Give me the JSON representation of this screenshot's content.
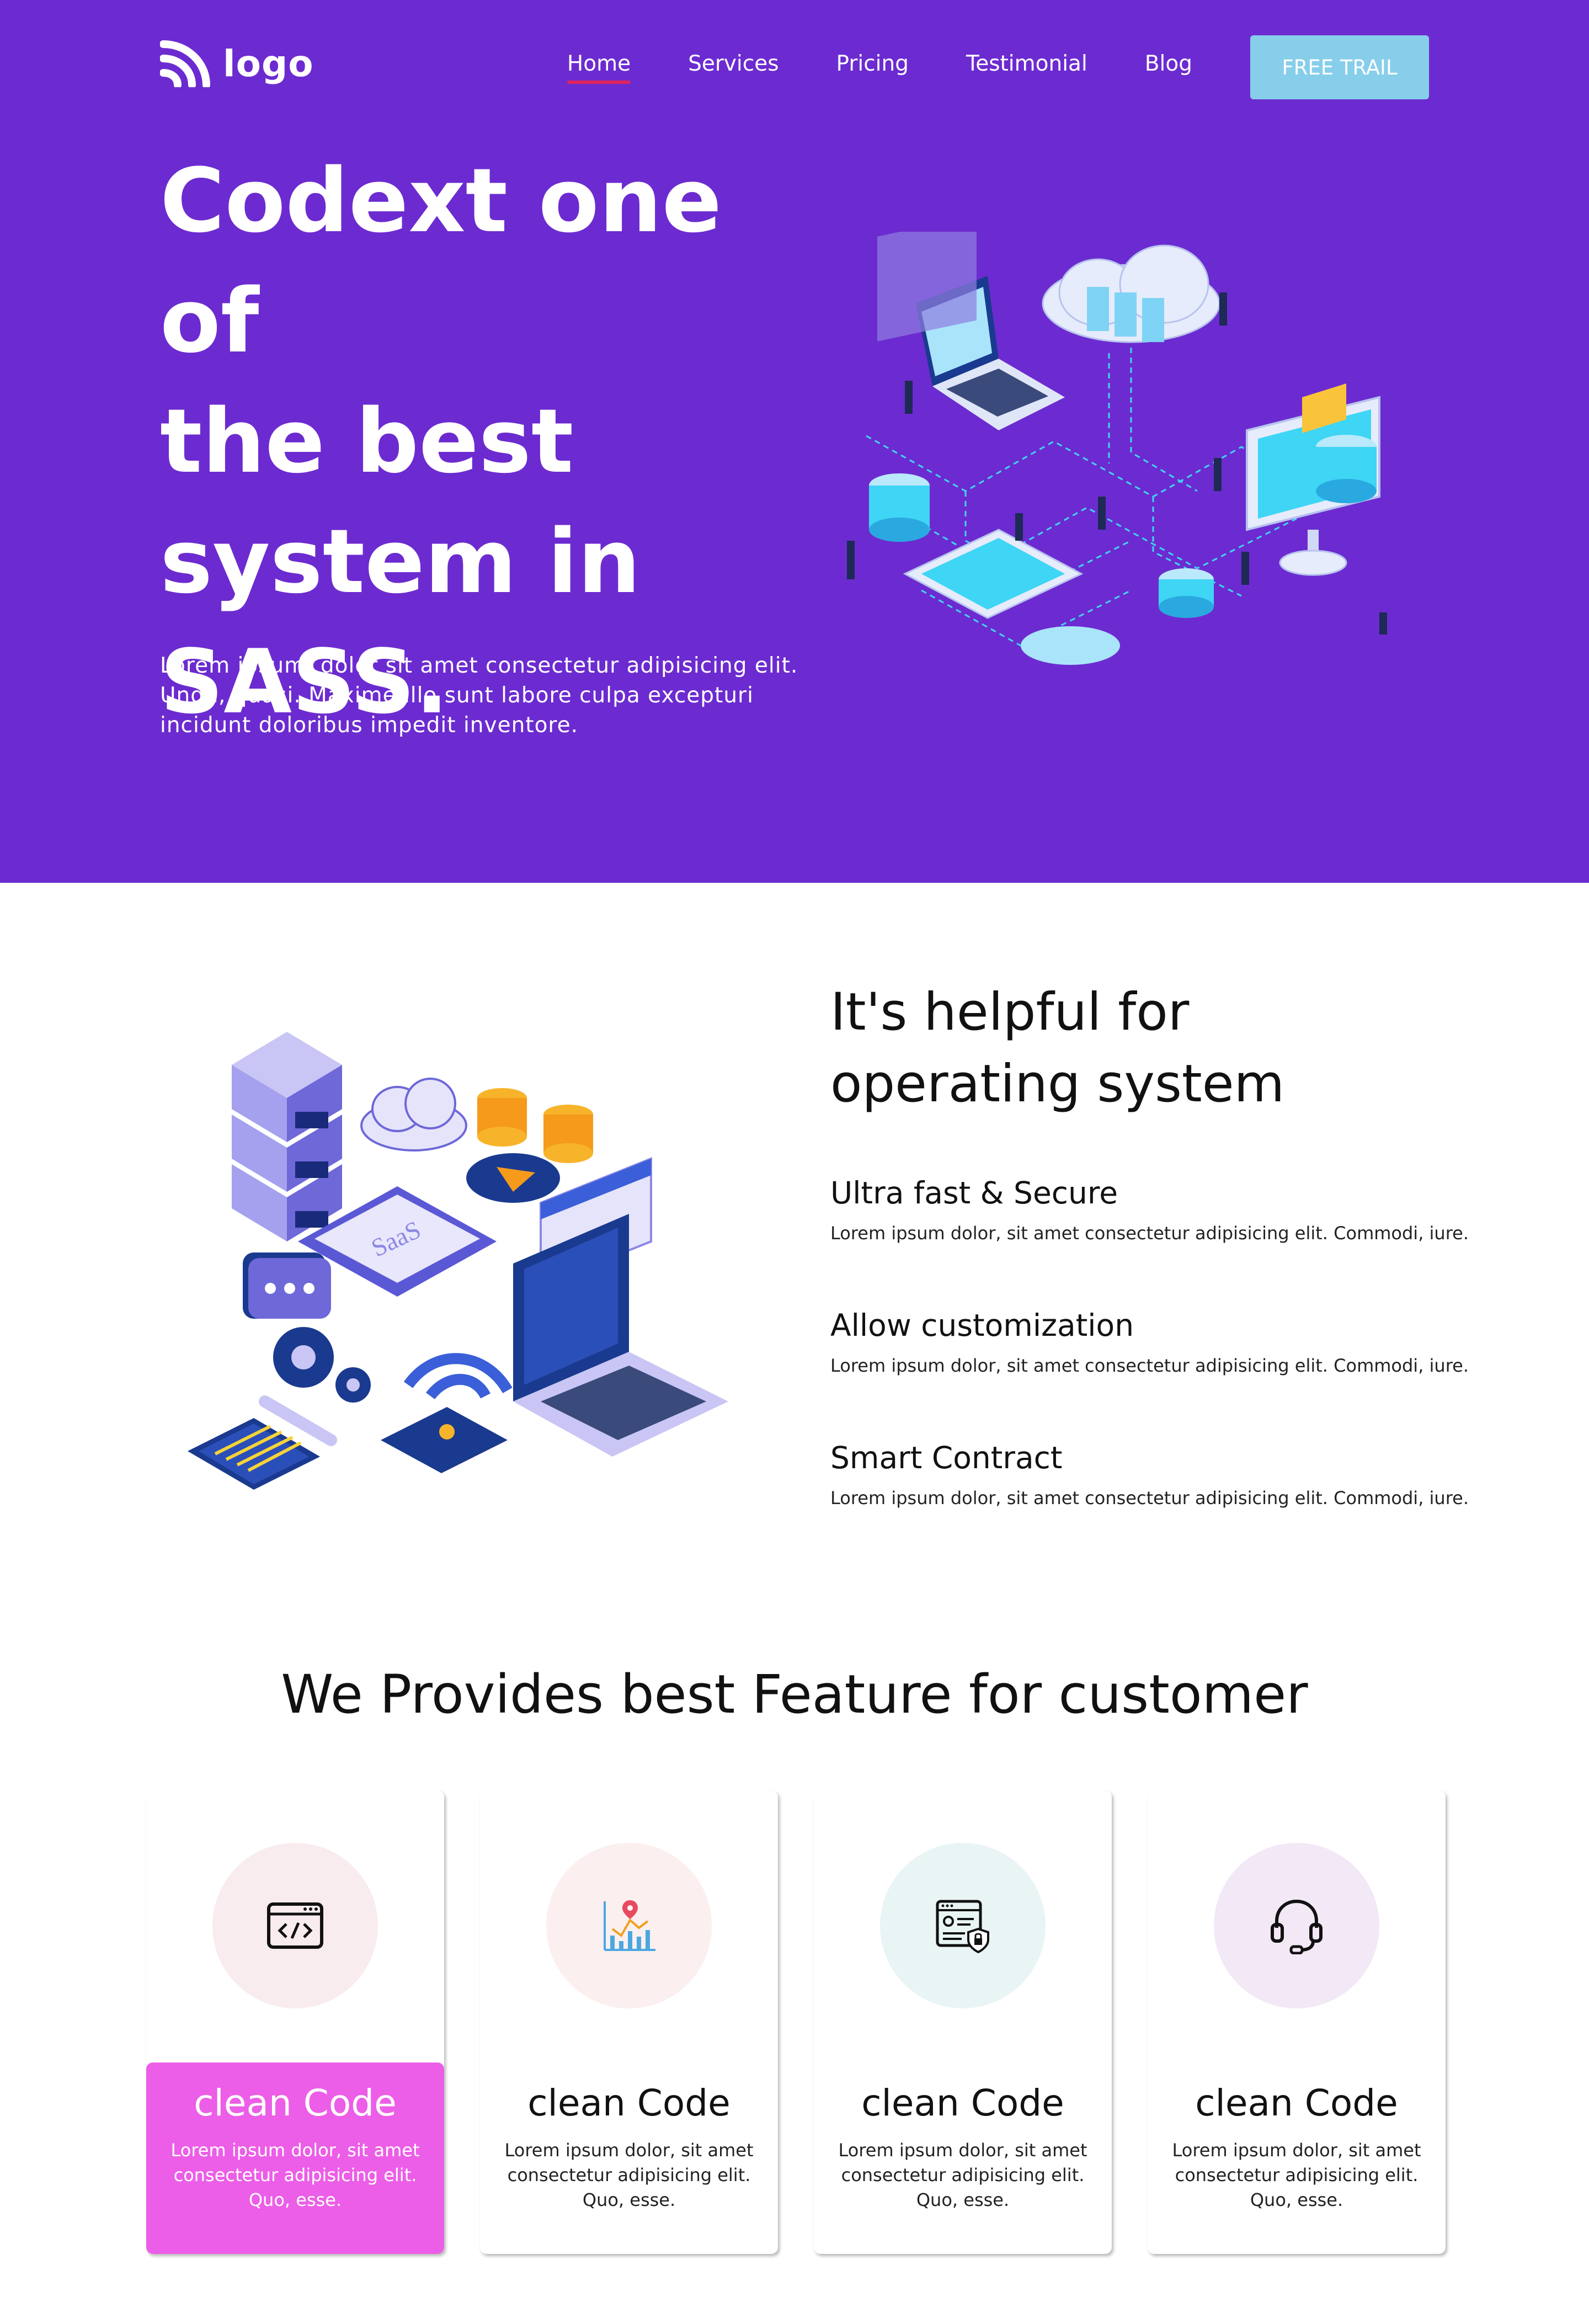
{
  "nav": {
    "logo_text": "logo",
    "items": [
      {
        "label": "Home",
        "active": true
      },
      {
        "label": "Services"
      },
      {
        "label": "Pricing"
      },
      {
        "label": "Testimonial"
      },
      {
        "label": "Blog"
      }
    ],
    "cta_label": "FREE TRAIL"
  },
  "hero": {
    "title_lines": [
      "Codext one of",
      "the best",
      "system in",
      "SASS."
    ],
    "description": "Lorem ipsum, dolor sit amet consectetur adipisicing elit. Unde, quasi. Maxime illo sunt labore culpa excepturi incidunt doloribus impedit inventore."
  },
  "helpful": {
    "title_lines": [
      "It's helpful for",
      "operating system"
    ],
    "illustration_badge": "SaaS",
    "features": [
      {
        "title": "Ultra fast & Secure",
        "text": "Lorem ipsum dolor, sit amet consectetur adipisicing elit. Commodi, iure."
      },
      {
        "title": "Allow customization",
        "text": "Lorem ipsum dolor, sit amet consectetur adipisicing elit. Commodi, iure."
      },
      {
        "title": "Smart Contract",
        "text": "Lorem ipsum dolor, sit amet consectetur adipisicing elit. Commodi, iure."
      }
    ]
  },
  "features_section": {
    "title": "We Provides best Feature for customer",
    "cards": [
      {
        "icon": "code-window-icon",
        "circle_color": "#f9ecee",
        "title": "clean Code",
        "text": "Lorem ipsum dolor, sit amet consectetur adipisicing elit. Quo, esse.",
        "highlighted": true
      },
      {
        "icon": "chart-location-icon",
        "circle_color": "#fbefef",
        "title": "clean Code",
        "text": "Lorem ipsum dolor, sit amet consectetur adipisicing elit. Quo, esse.",
        "highlighted": false
      },
      {
        "icon": "secure-document-icon",
        "circle_color": "#e9f4f5",
        "title": "clean Code",
        "text": "Lorem ipsum dolor, sit amet consectetur adipisicing elit. Quo, esse.",
        "highlighted": false
      },
      {
        "icon": "headset-icon",
        "circle_color": "#f2e8f6",
        "title": "clean Code",
        "text": "Lorem ipsum dolor, sit amet consectetur adipisicing elit. Quo, esse.",
        "highlighted": false
      }
    ]
  },
  "colors": {
    "hero_bg": "#6c2bd0",
    "cta_bg": "#87ceeb",
    "active_underline": "#e0245e",
    "highlight_card": "#ec5ee7"
  }
}
